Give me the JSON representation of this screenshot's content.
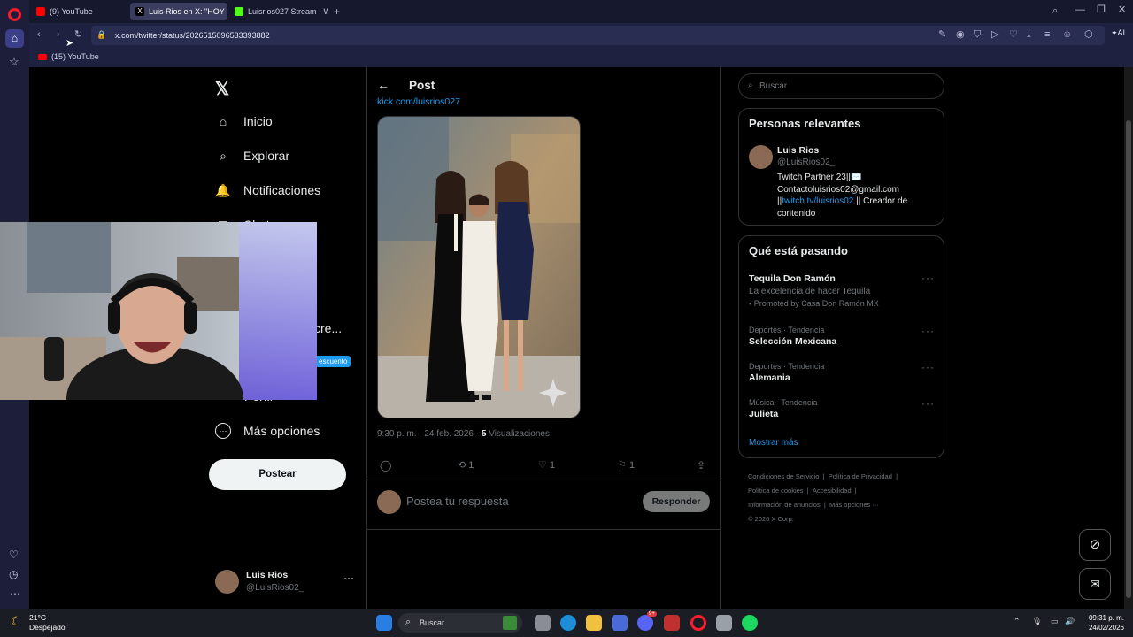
{
  "browser": {
    "tabs": [
      {
        "label": "(9) YouTube",
        "color": "#ff0000"
      },
      {
        "label": "Luis Rios en X: \"HOY ME V",
        "color": "#000000"
      },
      {
        "label": "Luisrios027 Stream - Watc",
        "color": "#53fc18"
      }
    ],
    "url": "x.com/twitter/status/2026515096533393882",
    "bookmark": "(15) YouTube",
    "ai_label": "AI"
  },
  "nav": {
    "items": [
      {
        "label": "Inicio",
        "icon": "home-icon"
      },
      {
        "label": "Explorar",
        "icon": "search-icon"
      },
      {
        "label": "Notificaciones",
        "icon": "bell-icon"
      },
      {
        "label": "Chat",
        "icon": "chat-icon"
      },
      {
        "label": "Más opciones",
        "icon": "more-circle-icon"
      }
    ],
    "partial_cre": "cre...",
    "discount_badge": "escuento",
    "profile_partial": "Perfil",
    "post_button": "Postear",
    "account": {
      "name": "Luis Rios",
      "handle": "@LuisRios02_"
    }
  },
  "post": {
    "header": "Post",
    "link": "kick.com/luisrios027",
    "meta_time": "9:30 p. m. · 24 feb. 2026 · ",
    "views_count": "5",
    "views_label": " Visualizaciones",
    "actions": {
      "reposts": "1",
      "likes": "1",
      "bookmarks": "1"
    },
    "reply_placeholder": "Postea tu respuesta",
    "reply_button": "Responder"
  },
  "right": {
    "search_placeholder": "Buscar",
    "relevant_title": "Personas relevantes",
    "person": {
      "name": "Luis Rios",
      "handle": "@LuisRios02_",
      "bio_1": "Twitch Partner 23||✉️",
      "bio_2": "Contactoluisrios02@gmail.com",
      "bio_3a": "||",
      "bio_3_link": "twitch.tv/luisrios02",
      "bio_3b": " || Creador de",
      "bio_4": "contenido"
    },
    "trends_title": "Qué está pasando",
    "trends": [
      {
        "name": "Tequila Don Ramón",
        "desc": "La excelencia de hacer Tequila",
        "promo": "Promoted by Casa Don Ramón MX"
      },
      {
        "meta": "Deportes · Tendencia",
        "name": "Selección Mexicana"
      },
      {
        "meta": "Deportes · Tendencia",
        "name": "Alemania"
      },
      {
        "meta": "Música · Tendencia",
        "name": "Julieta"
      }
    ],
    "show_more": "Mostrar más",
    "footer": [
      [
        "Condiciones de Servicio",
        "|",
        "Política de Privacidad",
        "|"
      ],
      [
        "Política de cookies",
        "|",
        "Accesibilidad",
        "|"
      ],
      [
        "Información de anuncios",
        "|",
        "Más opciones ···"
      ],
      [
        "© 2026 X Corp."
      ]
    ]
  },
  "taskbar": {
    "temp": "21°C",
    "weather": "Despejado",
    "search": "Buscar",
    "time": "09:31 p. m.",
    "date": "24/02/2026",
    "discord_badge": "9+"
  },
  "colors": {
    "accent": "#1d9bf0",
    "chrome": "#1f2140",
    "border": "#2f3336"
  }
}
